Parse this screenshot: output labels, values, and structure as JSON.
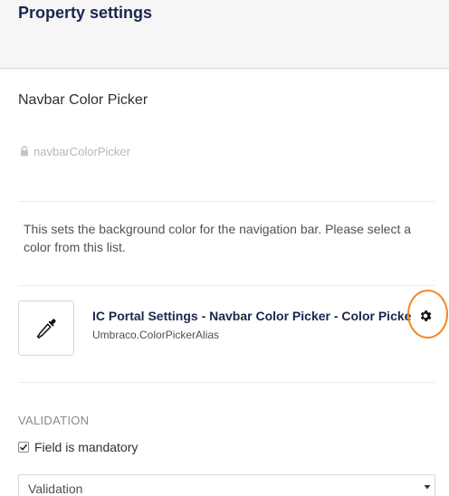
{
  "header": {
    "title": "Property settings"
  },
  "property": {
    "name": "Navbar Color Picker",
    "alias": "navbarColorPicker",
    "description": "This sets the background color for the navigation bar. Please select a color from this list."
  },
  "editor": {
    "name": "IC Portal Settings - Navbar Color Picker - Color Picker",
    "alias": "Umbraco.ColorPickerAlias",
    "icon": "eyedropper-icon",
    "settings_icon": "gear-icon"
  },
  "validation": {
    "heading": "VALIDATION",
    "mandatory_label": "Field is mandatory",
    "mandatory_checked": true,
    "select_value": "Validation"
  },
  "colors": {
    "highlight": "#f08a24",
    "text": "#1b264f"
  }
}
